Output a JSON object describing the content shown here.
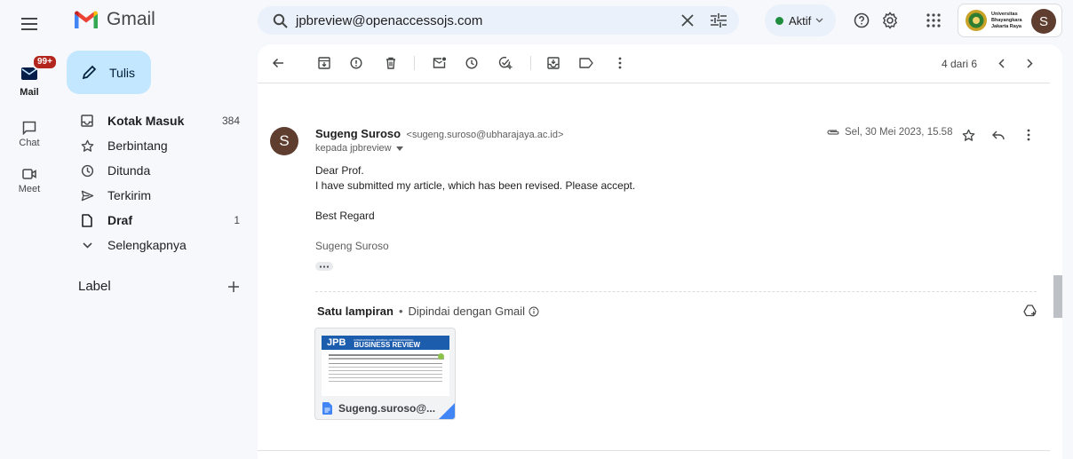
{
  "app": {
    "name": "Gmail"
  },
  "search": {
    "query": "jpbreview@openaccessojs.com"
  },
  "status": {
    "label": "Aktif"
  },
  "account": {
    "org_line1": "Universitas",
    "org_line2": "Bhayangkara",
    "org_line3": "Jakarta Raya",
    "avatar_letter": "S"
  },
  "rail": {
    "mail_label": "Mail",
    "mail_badge": "99+",
    "chat_label": "Chat",
    "meet_label": "Meet"
  },
  "compose": {
    "label": "Tulis"
  },
  "nav": {
    "items": [
      {
        "label": "Kotak Masuk",
        "count": "384"
      },
      {
        "label": "Berbintang",
        "count": ""
      },
      {
        "label": "Ditunda",
        "count": ""
      },
      {
        "label": "Terkirim",
        "count": ""
      },
      {
        "label": "Draf",
        "count": "1"
      },
      {
        "label": "Selengkapnya",
        "count": ""
      }
    ],
    "labels_header": "Label"
  },
  "toolbar": {
    "pagination": "4 dari 6"
  },
  "email": {
    "sender_initial": "S",
    "sender_name": "Sugeng Suroso",
    "sender_email": "<sugeng.suroso@ubharajaya.ac.id>",
    "to_line": "kepada jpbreview",
    "date": "Sel, 30 Mei 2023, 15.58",
    "body": {
      "greeting": "Dear Prof.",
      "line1": "I have submitted my article, which has been revised. Please accept.",
      "closing": "Best Regard",
      "signature": "Sugeng Suroso"
    }
  },
  "attachments": {
    "title": "Satu lampiran",
    "scan_note": "Dipindai dengan Gmail",
    "file_name": "Sugeng.suroso@...",
    "thumb_logo": "JPB",
    "thumb_title_small": "INTERNATIONAL JOURNAL OF PROFESSIONAL",
    "thumb_title": "BUSINESS REVIEW"
  },
  "colors": {
    "accent_blue": "#0b57d0",
    "compose_bg": "#c2e7ff",
    "avatar_bg": "#5f3e2f",
    "gmail_red": "#ea4335"
  }
}
